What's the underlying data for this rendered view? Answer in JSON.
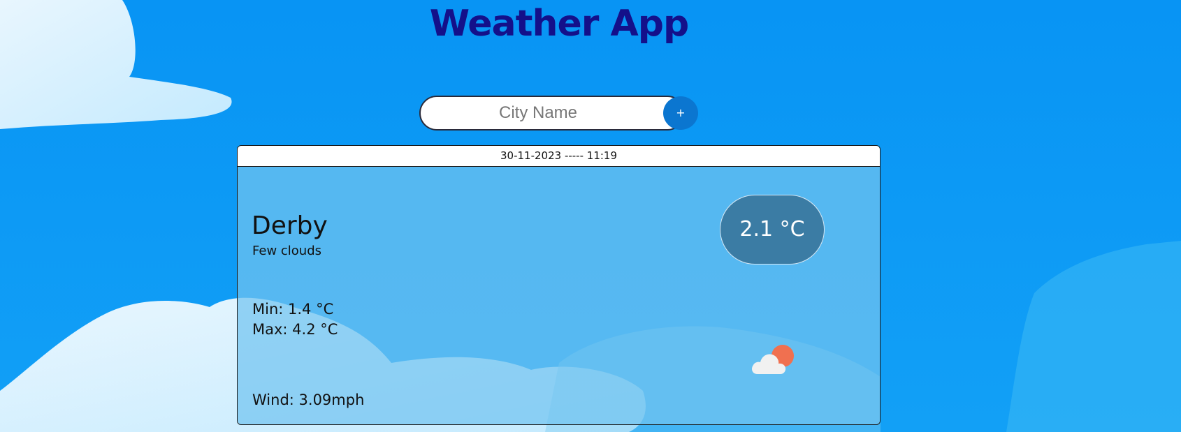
{
  "app": {
    "title": "Weather App"
  },
  "search": {
    "placeholder": "City Name",
    "value": "",
    "button_label": "+"
  },
  "card": {
    "datetime": "30-11-2023 ----- 11:19",
    "city": "Derby",
    "condition": "Few clouds",
    "temperature": "2.1 °C",
    "min": "Min: 1.4 °C",
    "max": "Max: 4.2 °C",
    "wind": "Wind: 3.09mph",
    "icon": "partly-cloudy-icon"
  },
  "colors": {
    "title": "#14108a",
    "background": "#0a96f5",
    "button": "#0b76d0",
    "temp_pill": "#3b7ca4",
    "sun": "#f07050"
  }
}
